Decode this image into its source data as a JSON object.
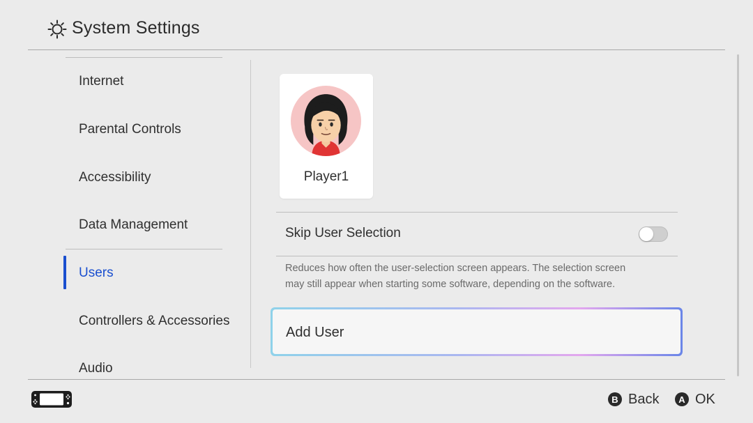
{
  "header": {
    "title": "System Settings",
    "icon": "gear-icon"
  },
  "sidebar": {
    "items": [
      {
        "label": "Internet"
      },
      {
        "label": "Parental Controls"
      },
      {
        "label": "Accessibility"
      },
      {
        "label": "Data Management"
      },
      {
        "label": "Users"
      },
      {
        "label": "Controllers & Accessories"
      },
      {
        "label": "Audio"
      }
    ],
    "selected": "Users",
    "accent_color": "#1a4fcf"
  },
  "main": {
    "user": {
      "name": "Player1",
      "avatar_bg": "#f6c5c5"
    },
    "skip_user_selection": {
      "label": "Skip User Selection",
      "enabled": false
    },
    "description": {
      "line1": "Reduces how often the user-selection screen appears. The selection screen",
      "line2": "may still appear when starting some software, depending on the software."
    },
    "add_user": {
      "label": "Add User"
    }
  },
  "footer": {
    "console_icon": "handheld-console-icon",
    "back": {
      "glyph": "B",
      "label": "Back"
    },
    "ok": {
      "glyph": "A",
      "label": "OK"
    }
  }
}
